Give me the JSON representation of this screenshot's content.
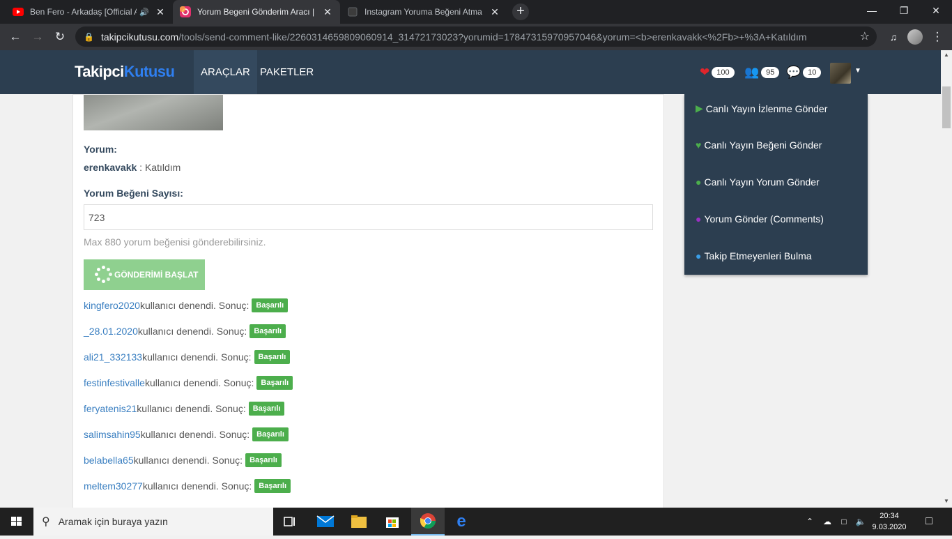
{
  "browser": {
    "tabs": [
      {
        "title": "Ben Fero - Arkadaş [Official A",
        "icon": "youtube-icon",
        "audio": true
      },
      {
        "title": "Yorum Begeni Gönderim Aracı | Ins",
        "icon": "takipcikutusu-icon",
        "active": true
      },
      {
        "title": "Instagram Yoruma Beğeni Atma İ",
        "icon": "page-icon"
      }
    ],
    "url_host": "takipcikutusu.com",
    "url_path": "/tools/send-comment-like/2260314659809060914_31472173023?yorumid=17847315970957046&yorum=<b>erenkavakk<%2Fb>+%3A+Katıldım"
  },
  "site": {
    "logo_part1": "Takipci",
    "logo_part2": "Kutusu",
    "nav": {
      "tools": "ARAÇLAR",
      "packages": "PAKETLER"
    },
    "stats": {
      "likes": "100",
      "followers": "95",
      "comments": "10"
    },
    "colors": {
      "navbar": "#2c3e50",
      "accent": "#2f7ff0",
      "success": "#4cae4c"
    }
  },
  "form": {
    "comment_label": "Yorum:",
    "comment_user": "erenkavakk",
    "comment_text": " : Katıldım",
    "count_label": "Yorum Beğeni Sayısı:",
    "count_value": "723",
    "hint": "Max 880 yorum beğenisi gönderebilirsiniz.",
    "start_button": "GÖNDERİMİ BAŞLAT"
  },
  "results": {
    "suffix": " kullanıcı denendi. Sonuç:",
    "badge": "Başarılı",
    "users": [
      "kingfero2020",
      "_28.01.2020",
      "ali21_332133",
      "festinfestivalle",
      "feryatenis21",
      "salimsahin95",
      "belabella65",
      "meltem30277"
    ]
  },
  "dropdown": {
    "items": [
      {
        "label": "Canlı Yayın İzlenme Gönder",
        "icon": "play-circle-icon",
        "color": "#4cae4c"
      },
      {
        "label": "Canlı Yayın Beğeni Gönder",
        "icon": "heartbeat-icon",
        "color": "#4cae4c"
      },
      {
        "label": "Canlı Yayın Yorum Gönder",
        "icon": "comments-icon",
        "color": "#4cae4c"
      },
      {
        "label": "Yorum Gönder (Comments)",
        "icon": "comment-icon",
        "color": "#9b30c2"
      },
      {
        "label": "Takip Etmeyenleri Bulma",
        "icon": "users-icon",
        "color": "#3a9ee8"
      }
    ]
  },
  "taskbar": {
    "search_placeholder": "Aramak için buraya yazın",
    "time": "20:34",
    "date": "9.03.2020"
  }
}
